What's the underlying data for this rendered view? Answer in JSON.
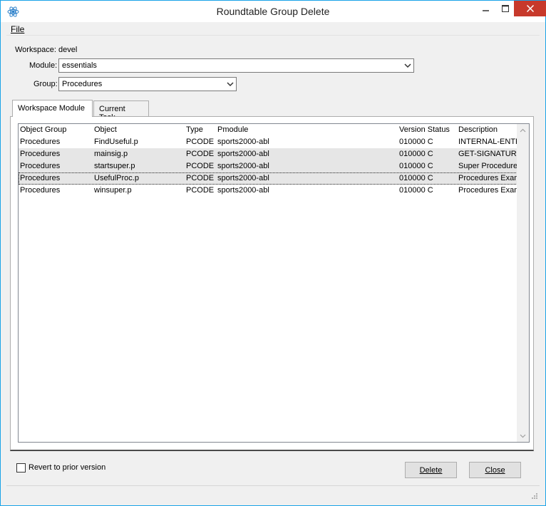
{
  "window": {
    "title": "Roundtable Group Delete",
    "icon": "atom-icon",
    "controls": {
      "minimize": "minimize-icon",
      "maximize": "maximize-icon",
      "close": "close-icon"
    }
  },
  "menu": {
    "file": "File"
  },
  "form": {
    "workspace_label": "Workspace:",
    "workspace_value": "devel",
    "module_label": "Module:",
    "module_value": "essentials",
    "group_label": "Group:",
    "group_value": "Procedures"
  },
  "tabs": [
    {
      "label": "Workspace Module",
      "active": true
    },
    {
      "label": "Current Task",
      "active": false
    }
  ],
  "table": {
    "columns": [
      "Object Group",
      "Object",
      "Type",
      "Pmodule",
      "Version Status",
      "Description"
    ],
    "rows": [
      [
        "Procedures",
        "FindUseful.p",
        "PCODE",
        "sports2000-abl",
        "010000 C",
        "INTERNAL-ENTR"
      ],
      [
        "Procedures",
        "mainsig.p",
        "PCODE",
        "sports2000-abl",
        "010000 C",
        "GET-SIGNATURI"
      ],
      [
        "Procedures",
        "startsuper.p",
        "PCODE",
        "sports2000-abl",
        "010000 C",
        "Super Procedure"
      ],
      [
        "Procedures",
        "UsefulProc.p",
        "PCODE",
        "sports2000-abl",
        "010000 C",
        "Procedures Exam"
      ],
      [
        "Procedures",
        "winsuper.p",
        "PCODE",
        "sports2000-abl",
        "010000 C",
        "Procedures Exam"
      ]
    ]
  },
  "footer": {
    "revert_label": "Revert to prior version",
    "revert_checked": false,
    "delete_label": "Delete",
    "close_label": "Close"
  },
  "colors": {
    "window_border": "#1aa3e8",
    "close_button": "#c7392b",
    "row_alt": "#e6e6e6"
  }
}
